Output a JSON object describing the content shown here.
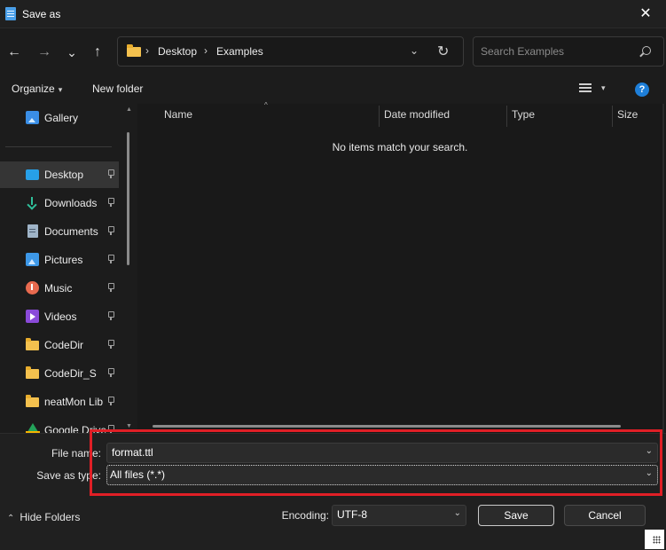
{
  "window": {
    "title": "Save as",
    "close_glyph": "✕"
  },
  "nav": {
    "back_glyph": "←",
    "forward_glyph": "→",
    "recent_glyph": "⌄",
    "up_glyph": "↑",
    "breadcrumb": [
      "Desktop",
      "Examples"
    ],
    "breadcrumb_sep": "›",
    "address_dropdown_glyph": "⌄",
    "refresh_glyph": "↻",
    "search_placeholder": "Search Examples"
  },
  "toolbar": {
    "organize_label": "Organize",
    "new_folder_label": "New folder",
    "caret_glyph": "▾",
    "help_glyph": "?"
  },
  "sidebar": {
    "items": [
      {
        "label": "Gallery",
        "icon": "gallery-icon",
        "pinned": false,
        "selected": false
      },
      {
        "label": "Desktop",
        "icon": "desktop-icon",
        "pinned": true,
        "selected": true
      },
      {
        "label": "Downloads",
        "icon": "downloads-icon",
        "pinned": true,
        "selected": false
      },
      {
        "label": "Documents",
        "icon": "documents-icon",
        "pinned": true,
        "selected": false
      },
      {
        "label": "Pictures",
        "icon": "pictures-icon",
        "pinned": true,
        "selected": false
      },
      {
        "label": "Music",
        "icon": "music-icon",
        "pinned": true,
        "selected": false
      },
      {
        "label": "Videos",
        "icon": "videos-icon",
        "pinned": true,
        "selected": false
      },
      {
        "label": "CodeDir",
        "icon": "folder-icon",
        "pinned": true,
        "selected": false
      },
      {
        "label": "CodeDir_S",
        "icon": "folder-icon",
        "pinned": true,
        "selected": false
      },
      {
        "label": "neatMon Lib",
        "icon": "folder-icon",
        "pinned": true,
        "selected": false
      },
      {
        "label": "Google Drive",
        "icon": "google-drive-icon",
        "pinned": true,
        "selected": false
      }
    ]
  },
  "content": {
    "columns": [
      "Name",
      "Date modified",
      "Type",
      "Size"
    ],
    "sort_glyph": "^",
    "empty_message": "No items match your search."
  },
  "form": {
    "file_name_label": "File name:",
    "file_name_value": "format.ttl",
    "save_type_label": "Save as type:",
    "save_type_value": "All files  (*.*)",
    "encoding_label": "Encoding:",
    "encoding_value": "UTF-8",
    "dropdown_glyph": "⌄"
  },
  "footer": {
    "hide_folders_label": "Hide Folders",
    "hide_folders_glyph": "⌃",
    "save_label": "Save",
    "cancel_label": "Cancel"
  },
  "colors": {
    "highlight_border": "#e01f26",
    "accent": "#1e7fd9"
  }
}
